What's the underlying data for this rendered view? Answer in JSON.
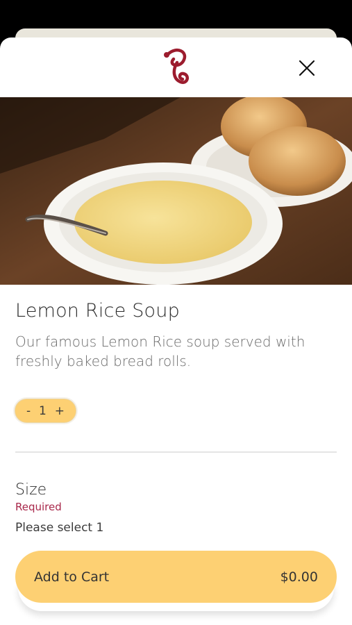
{
  "item": {
    "title": "Lemon Rice Soup",
    "description": "Our famous Lemon Rice soup served with freshly baked bread rolls."
  },
  "quantity": {
    "minus": "-",
    "value": "1",
    "plus": "+"
  },
  "options": {
    "label": "Size",
    "required": "Required",
    "instruction": "Please select 1"
  },
  "cart": {
    "button_label": "Add to Cart",
    "price": "$0.00"
  },
  "colors": {
    "accent": "#fdd073",
    "brand": "#a8274a"
  }
}
